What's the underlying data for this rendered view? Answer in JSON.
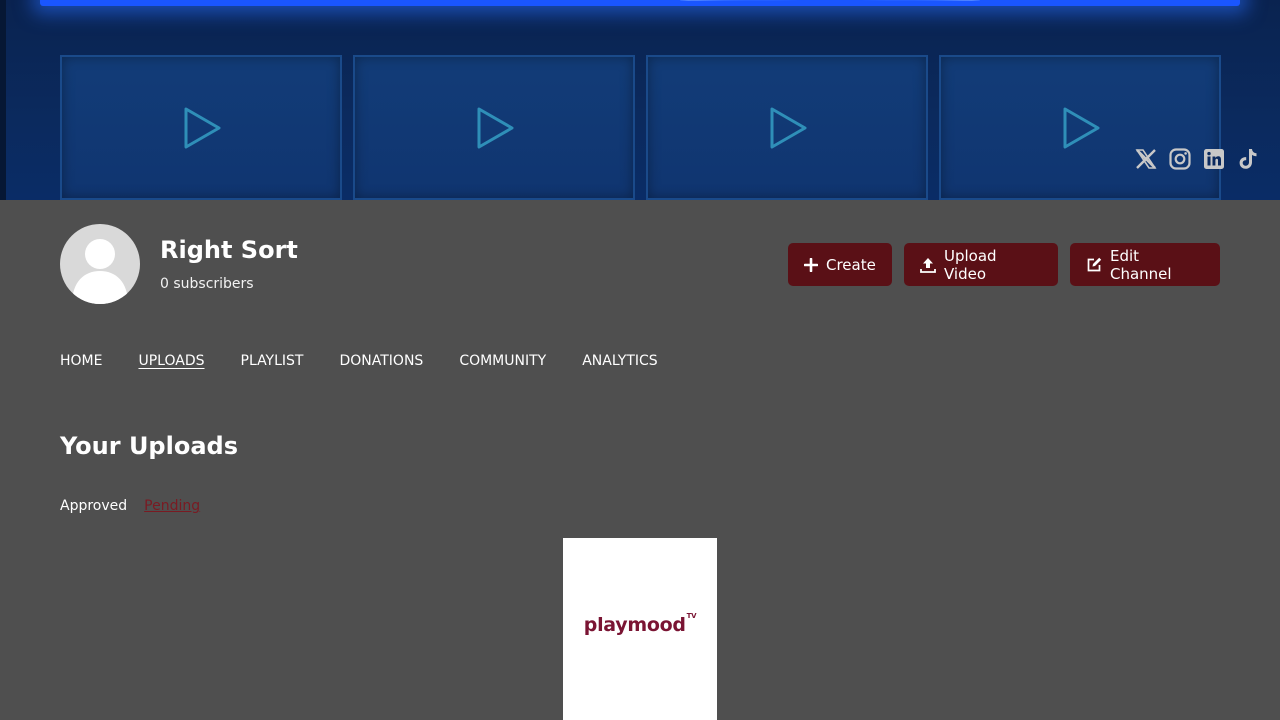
{
  "banner": {
    "play_icons": [
      "play-icon",
      "play-icon",
      "play-icon",
      "play-icon"
    ],
    "socials": [
      "x-icon",
      "instagram-icon",
      "linkedin-icon",
      "tiktok-icon"
    ]
  },
  "channel": {
    "name": "Right Sort",
    "subscribers": "0 subscribers"
  },
  "actions": {
    "create_label": "Create",
    "upload_label": "Upload Video",
    "edit_label": "Edit Channel"
  },
  "nav": {
    "items": [
      {
        "label": "HOME"
      },
      {
        "label": "UPLOADS"
      },
      {
        "label": "PLAYLIST"
      },
      {
        "label": "DONATIONS"
      },
      {
        "label": "COMMUNITY"
      },
      {
        "label": "ANALYTICS"
      }
    ],
    "active": "UPLOADS"
  },
  "uploads": {
    "title": "Your Uploads",
    "filter_approved": "Approved",
    "filter_pending": "Pending",
    "card_logo": "playmood",
    "card_logo_sup": "TV"
  },
  "colors": {
    "accent": "#5a1016",
    "pending_link": "#7a1a22",
    "background": "#4f4f4f"
  }
}
